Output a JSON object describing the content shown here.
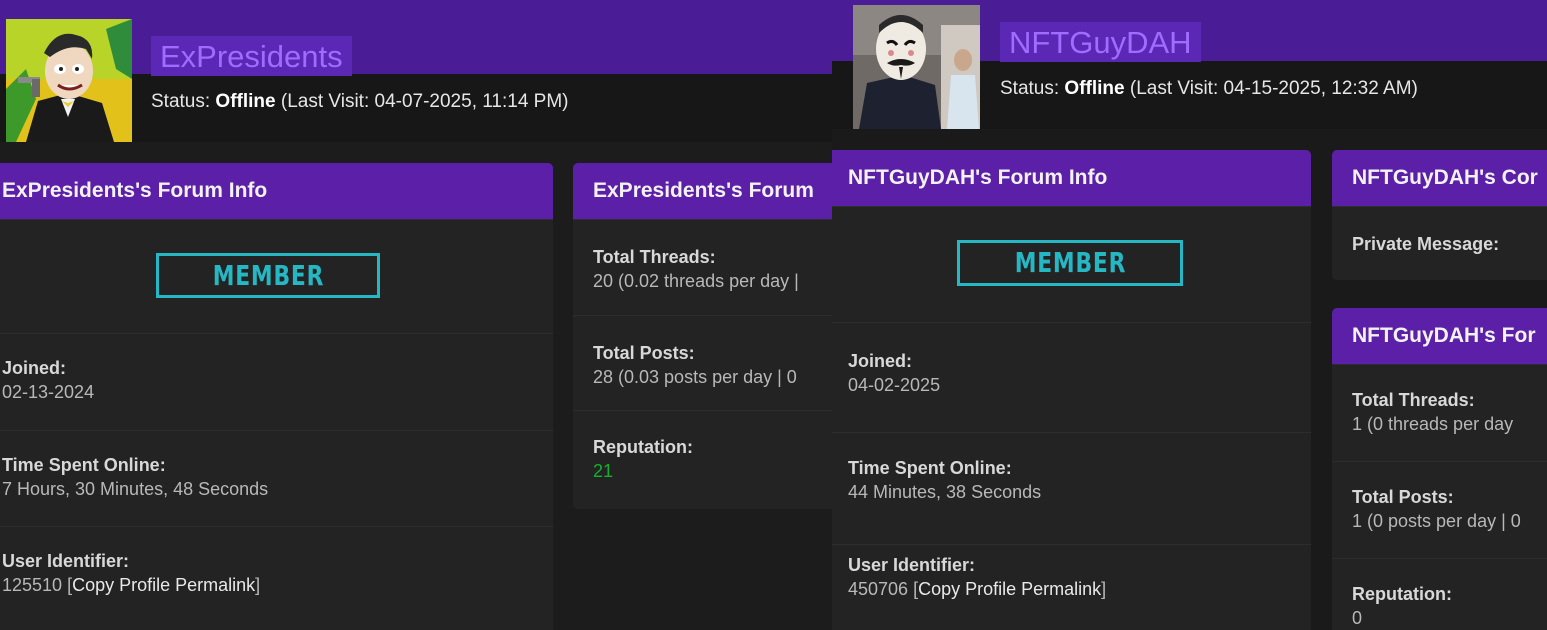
{
  "left": {
    "username": "ExPresidents",
    "status_prefix": "Status: ",
    "status_value": "Offline",
    "status_suffix": " (Last Visit: 04-07-2025, 11:14 PM)",
    "info_card": {
      "title": "ExPresidents's Forum Info",
      "badge": "MEMBER",
      "joined_label": "Joined:",
      "joined_value": "02-13-2024",
      "online_label": "Time Spent Online:",
      "online_value": "7 Hours, 30 Minutes, 48 Seconds",
      "uid_label": "User Identifier:",
      "uid_value": "125510",
      "uid_bracket_open": " [",
      "uid_link": "Copy Profile Permalink",
      "uid_bracket_close": "]"
    },
    "stats_card": {
      "title": "ExPresidents's Forum",
      "threads_label": "Total Threads:",
      "threads_value": "20 (0.02 threads per day |",
      "posts_label": "Total Posts:",
      "posts_value": "28 (0.03 posts per day | 0",
      "rep_label": "Reputation:",
      "rep_value": "21",
      "rep_color": "#12b22a"
    }
  },
  "right": {
    "username": "NFTGuyDAH",
    "status_prefix": "Status: ",
    "status_value": "Offline",
    "status_suffix": " (Last Visit: 04-15-2025, 12:32 AM)",
    "info_card": {
      "title": "NFTGuyDAH's Forum Info",
      "badge": "MEMBER",
      "joined_label": "Joined:",
      "joined_value": "04-02-2025",
      "online_label": "Time Spent Online:",
      "online_value": "44 Minutes, 38 Seconds",
      "uid_label": "User Identifier:",
      "uid_value": "450706",
      "uid_bracket_open": " [",
      "uid_link": "Copy Profile Permalink",
      "uid_bracket_close": "]"
    },
    "contact_card": {
      "title": "NFTGuyDAH's Cor",
      "pm_label": "Private Message:"
    },
    "stats_card": {
      "title": "NFTGuyDAH's For",
      "threads_label": "Total Threads:",
      "threads_value": "1 (0 threads per day",
      "posts_label": "Total Posts:",
      "posts_value": "1 (0 posts per day | 0",
      "rep_label": "Reputation:",
      "rep_value": "0"
    }
  },
  "colors": {
    "banner": "#4a1d96",
    "card_header": "#5b1fa8",
    "username_text": "#a06bff",
    "badge": "#25b8c4",
    "reputation_positive": "#12b22a"
  }
}
